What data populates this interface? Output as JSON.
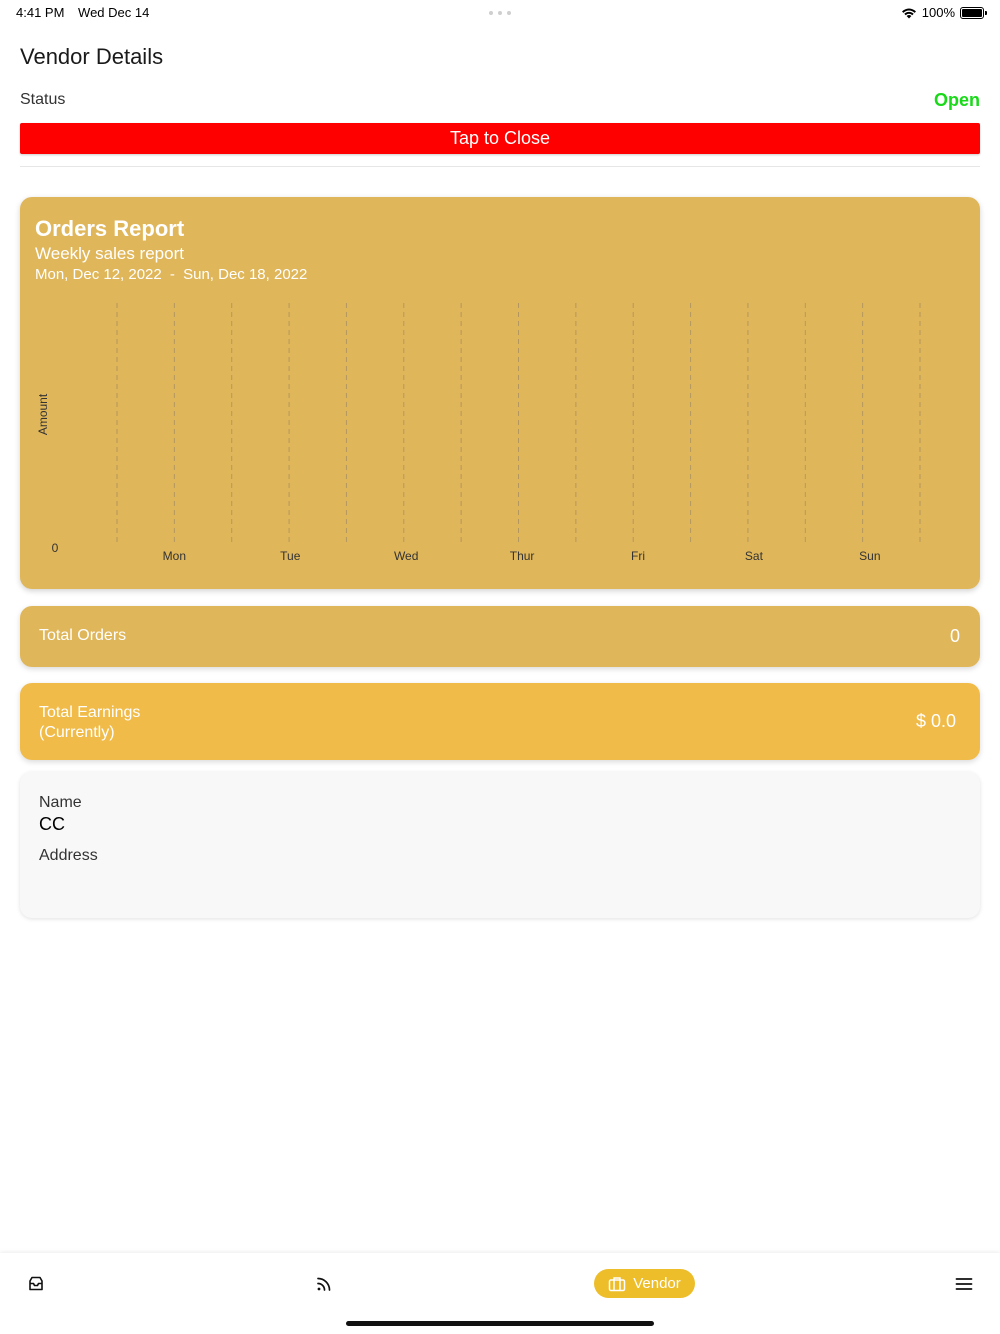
{
  "status_bar": {
    "time": "4:41 PM",
    "date": "Wed Dec 14",
    "battery": "100%"
  },
  "header": {
    "title": "Vendor Details",
    "status_label": "Status",
    "status_value": "Open",
    "status_color": "#19d919",
    "close_button": "Tap to Close",
    "close_button_color": "#ff0000"
  },
  "chart_data": {
    "type": "bar",
    "title": "Orders Report",
    "subtitle": "Weekly sales report",
    "date_start": "Mon, Dec 12, 2022",
    "date_separator": "-",
    "date_end": "Sun, Dec 18, 2022",
    "ylabel": "Amount",
    "xlabel": "",
    "categories": [
      "Mon",
      "Tue",
      "Wed",
      "Thur",
      "Fri",
      "Sat",
      "Sun"
    ],
    "values": [
      0,
      0,
      0,
      0,
      0,
      0,
      0
    ],
    "y_ticks": [
      "0"
    ],
    "grid": "vertical dashed",
    "background_color": "#e0b65a"
  },
  "summary": {
    "orders_label": "Total Orders",
    "orders_value": "0",
    "earnings_label_line1": "Total Earnings",
    "earnings_label_line2": "(Currently)",
    "earnings_value": "$ 0.0"
  },
  "info": {
    "name_label": "Name",
    "name_value": "CC",
    "address_label": "Address"
  },
  "bottom_nav": {
    "items": [
      {
        "icon": "inbox-icon"
      },
      {
        "icon": "feed-icon"
      },
      {
        "icon": "briefcase-icon",
        "label": "Vendor",
        "active": true
      },
      {
        "icon": "menu-icon"
      }
    ],
    "active_color": "#edbd2a"
  }
}
